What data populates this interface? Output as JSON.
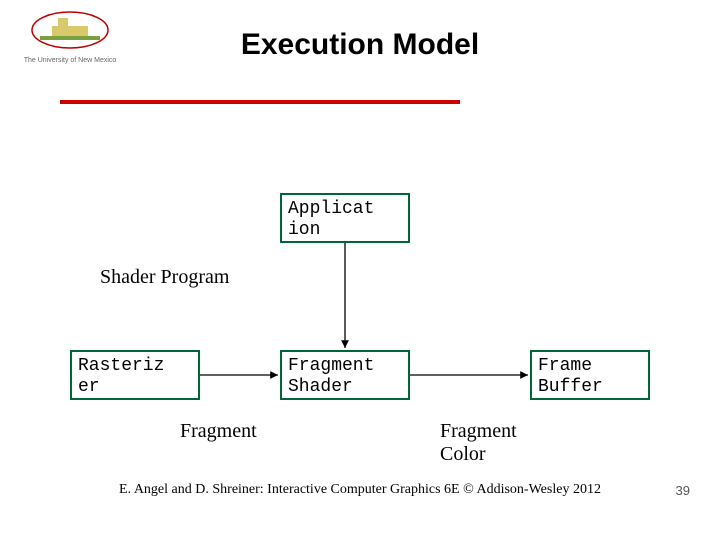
{
  "logo": {
    "caption": "The University of New Mexico"
  },
  "title": "Execution Model",
  "boxes": {
    "application": "Applicat\nion",
    "rasterizer": "Rasteriz\ner",
    "fragment_shader": "Fragment\nShader",
    "frame_buffer": "Frame\nBuffer"
  },
  "labels": {
    "shader_program": "Shader Program",
    "fragment": "Fragment",
    "fragment_color": "Fragment Color"
  },
  "footer": "E. Angel and D. Shreiner: Interactive Computer Graphics 6E © Addison-Wesley 2012",
  "page_number": "39",
  "colors": {
    "accent_red": "#cc0000",
    "box_border": "#00663a"
  },
  "chart_data": {
    "type": "flow-diagram",
    "nodes": [
      "Application",
      "Rasterizer",
      "Fragment Shader",
      "Frame Buffer"
    ],
    "edges": [
      {
        "from": "Application",
        "to": "Fragment Shader",
        "label": "Shader Program"
      },
      {
        "from": "Rasterizer",
        "to": "Fragment Shader",
        "label": "Fragment"
      },
      {
        "from": "Fragment Shader",
        "to": "Frame Buffer",
        "label": "Fragment Color"
      }
    ]
  }
}
